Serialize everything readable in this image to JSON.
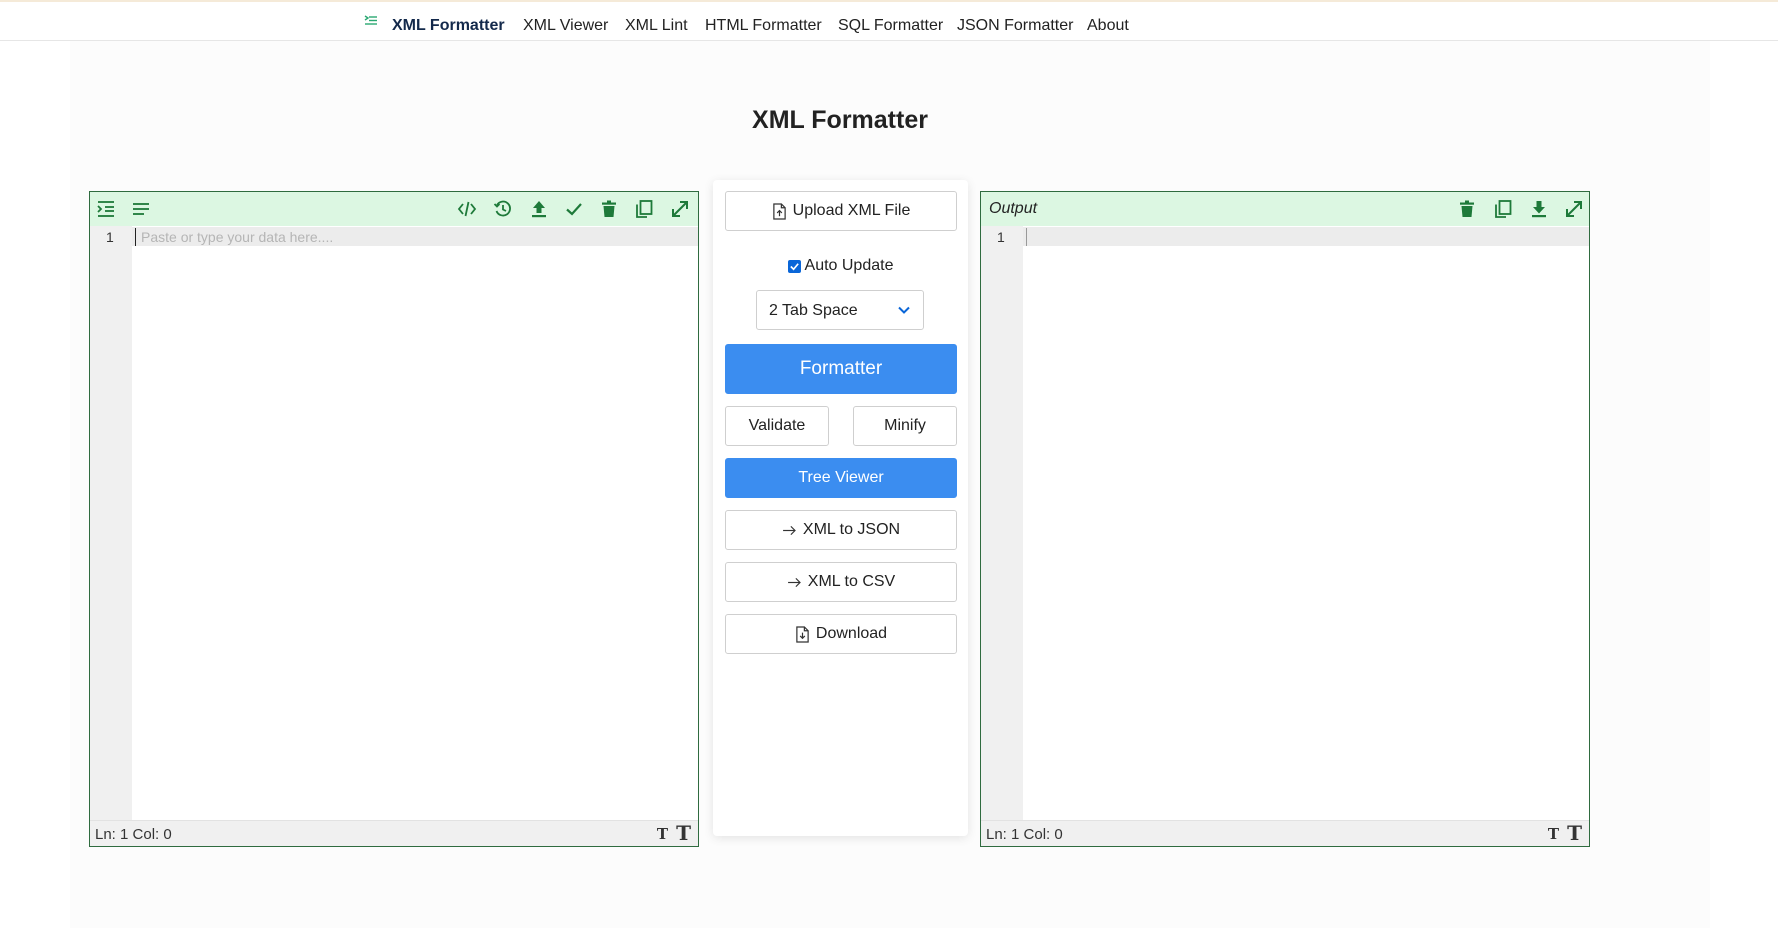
{
  "nav": {
    "items": [
      {
        "label": "XML Formatter",
        "active": true
      },
      {
        "label": "XML Viewer"
      },
      {
        "label": "XML Lint"
      },
      {
        "label": "HTML Formatter"
      },
      {
        "label": "SQL Formatter"
      },
      {
        "label": "JSON Formatter"
      },
      {
        "label": "About"
      }
    ]
  },
  "page": {
    "title": "XML Formatter"
  },
  "input_editor": {
    "line_number": "1",
    "placeholder": "Paste or type your data here....",
    "status": "Ln: 1 Col: 0",
    "font_small": "T",
    "font_big": "T",
    "toolbar_icons": [
      "indent-icon",
      "wrap-lines-icon",
      "code-icon",
      "history-icon",
      "upload-icon",
      "check-icon",
      "trash-icon",
      "copy-icon",
      "expand-icon"
    ]
  },
  "output_editor": {
    "label": "Output",
    "line_number": "1",
    "status": "Ln: 1 Col: 0",
    "font_small": "T",
    "font_big": "T",
    "toolbar_icons": [
      "trash-icon",
      "copy-icon",
      "download-icon",
      "expand-icon"
    ]
  },
  "controls": {
    "upload_label": "Upload XML File",
    "auto_update_label": "Auto Update",
    "auto_update_checked": true,
    "indent_selected": "2 Tab Space",
    "formatter_label": "Formatter",
    "validate_label": "Validate",
    "minify_label": "Minify",
    "tree_viewer_label": "Tree Viewer",
    "xml_to_json_label": "XML to JSON",
    "xml_to_csv_label": "XML to CSV",
    "download_label": "Download"
  },
  "colors": {
    "accent_green": "#1e7a3a",
    "toolbar_bg": "#dcf7e2",
    "primary_blue": "#3b8df0"
  }
}
